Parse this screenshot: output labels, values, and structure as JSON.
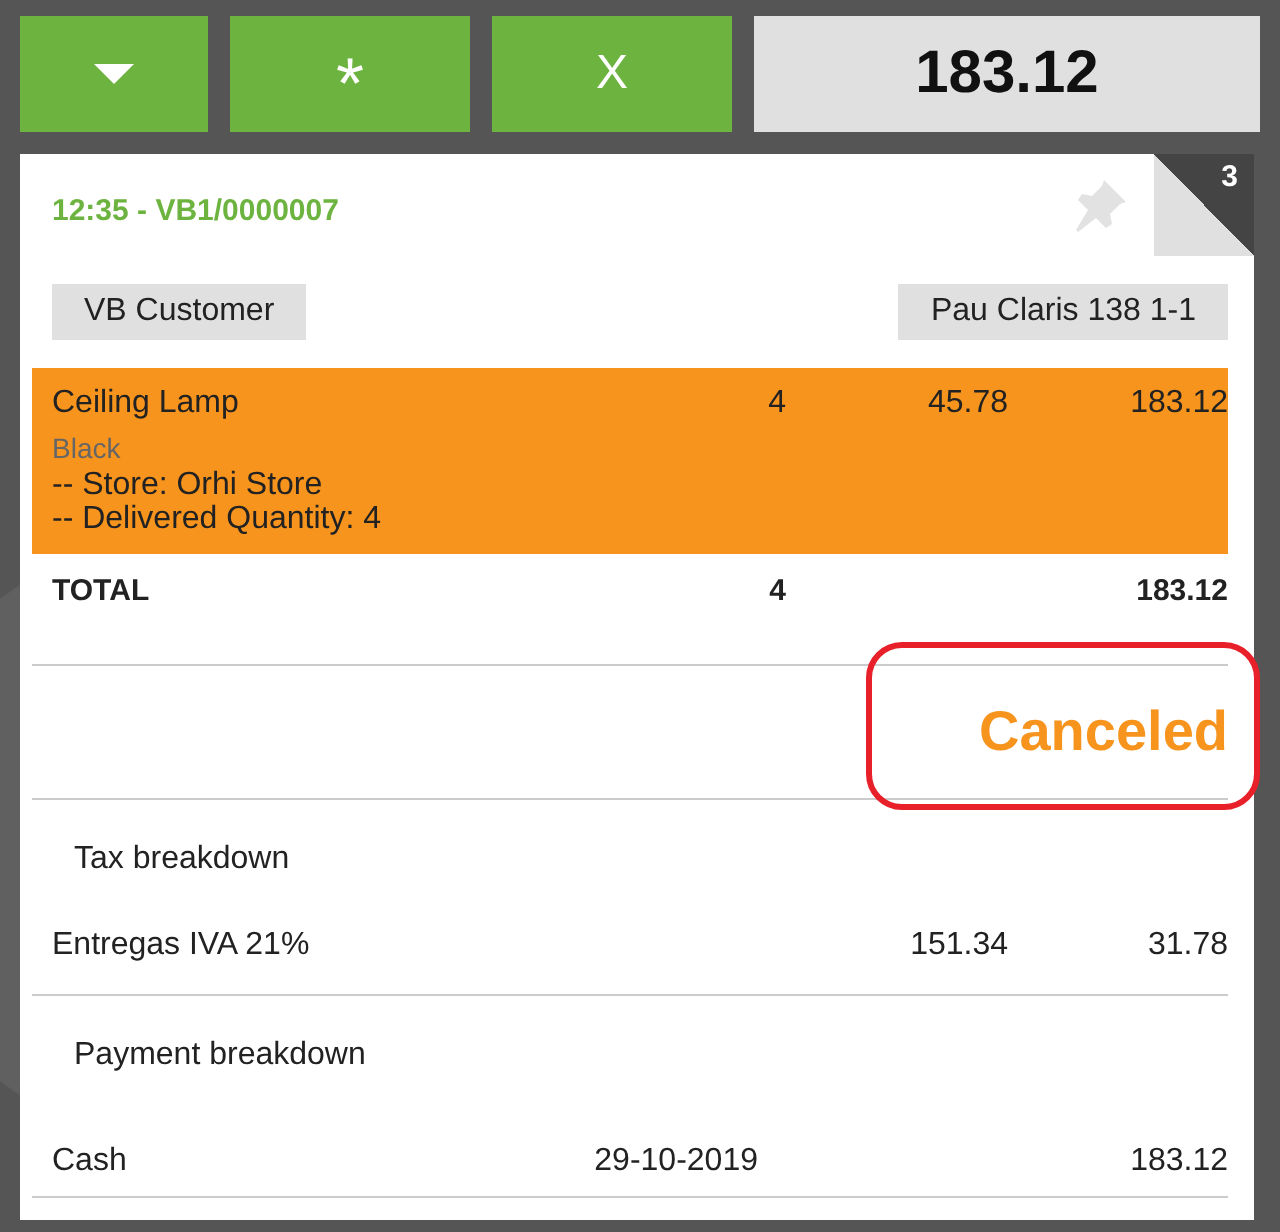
{
  "toolbar": {
    "buttons": [
      {
        "kind": "icon"
      },
      {
        "kind": "text",
        "label": "*"
      },
      {
        "kind": "text",
        "label": "X"
      }
    ],
    "total": "183.12"
  },
  "ticket": {
    "title": "12:35 - VB1/0000007",
    "count": "3",
    "customer": "VB Customer",
    "address": "Pau Claris 138 1-1",
    "lines": [
      {
        "name": "Ceiling Lamp",
        "qty": "4",
        "price": "45.78",
        "total": "183.12",
        "variant": "Black",
        "details": [
          "-- Store: Orhi Store",
          "-- Delivered Quantity: 4"
        ],
        "selected": true
      }
    ],
    "totals": {
      "label": "TOTAL",
      "qty": "4",
      "total": "183.12"
    },
    "status": {
      "text": "Canceled",
      "highlighted": true
    },
    "tax": {
      "title": "Tax breakdown",
      "rows": [
        {
          "name": "Entregas IVA 21%",
          "base": "151.34",
          "amount": "31.78"
        }
      ]
    },
    "payments": {
      "title": "Payment breakdown",
      "rows": [
        {
          "method": "Cash",
          "date": "29-10-2019",
          "amount": "183.12"
        }
      ]
    }
  }
}
